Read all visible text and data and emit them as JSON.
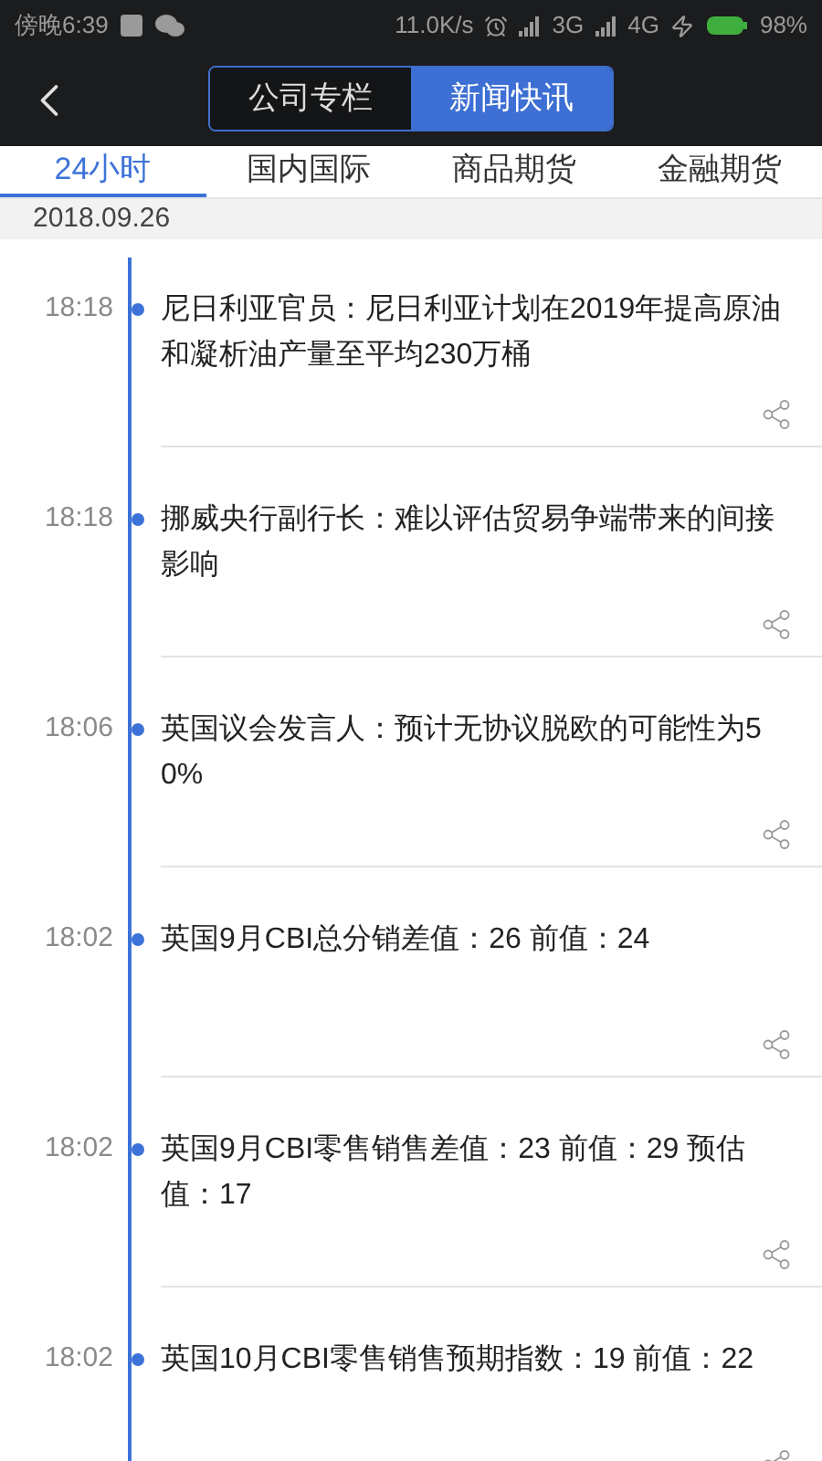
{
  "status_bar": {
    "time": "傍晚6:39",
    "speed": "11.0K/s",
    "network_1": "3G",
    "network_2": "4G",
    "battery": "98%"
  },
  "header": {
    "segments": [
      {
        "label": "公司专栏",
        "selected": false
      },
      {
        "label": "新闻快讯",
        "selected": true
      }
    ]
  },
  "tabs": [
    {
      "label": "24小时",
      "selected": true
    },
    {
      "label": "国内国际",
      "selected": false
    },
    {
      "label": "商品期货",
      "selected": false
    },
    {
      "label": "金融期货",
      "selected": false
    }
  ],
  "date": "2018.09.26",
  "news": [
    {
      "time": "18:18",
      "text": "尼日利亚官员：尼日利亚计划在2019年提高原油和凝析油产量至平均230万桶"
    },
    {
      "time": "18:18",
      "text": "挪威央行副行长：难以评估贸易争端带来的间接影响"
    },
    {
      "time": "18:06",
      "text": "英国议会发言人：预计无协议脱欧的可能性为50%"
    },
    {
      "time": "18:02",
      "text": "英国9月CBI总分销差值：26 前值：24"
    },
    {
      "time": "18:02",
      "text": "英国9月CBI零售销售差值：23 前值：29 预估值：17"
    },
    {
      "time": "18:02",
      "text": "英国10月CBI零售销售预期指数：19 前值：22"
    }
  ]
}
